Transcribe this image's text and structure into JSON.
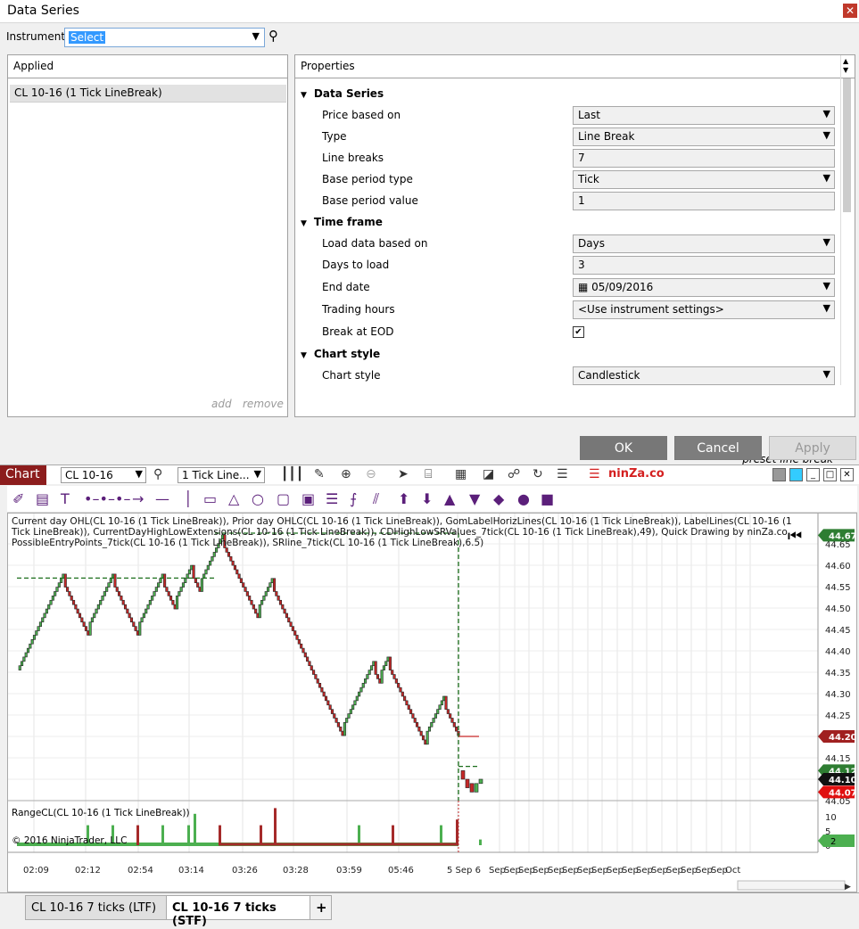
{
  "dialog": {
    "title": "Data Series",
    "close": "✕"
  },
  "instrument": {
    "label": "Instrument",
    "value": "Select"
  },
  "applied": {
    "header": "Applied",
    "items": [
      "CL 10-16 (1 Tick LineBreak)"
    ],
    "add": "add",
    "remove": "remove"
  },
  "properties": {
    "header": "Properties",
    "sections": [
      {
        "title": "Data Series",
        "rows": [
          {
            "label": "Price based on",
            "value": "Last",
            "kind": "select"
          },
          {
            "label": "Type",
            "value": "Line Break",
            "kind": "select"
          },
          {
            "label": "Line breaks",
            "value": "7",
            "kind": "text"
          },
          {
            "label": "Base period type",
            "value": "Tick",
            "kind": "select"
          },
          {
            "label": "Base period value",
            "value": "1",
            "kind": "text"
          }
        ]
      },
      {
        "title": "Time frame",
        "rows": [
          {
            "label": "Load data based on",
            "value": "Days",
            "kind": "select"
          },
          {
            "label": "Days to load",
            "value": "3",
            "kind": "text"
          },
          {
            "label": "End date",
            "value": "05/09/2016",
            "kind": "date"
          },
          {
            "label": "Trading hours",
            "value": "<Use instrument settings>",
            "kind": "select"
          },
          {
            "label": "Break at EOD",
            "value": "✔",
            "kind": "check"
          }
        ]
      },
      {
        "title": "Chart style",
        "rows": [
          {
            "label": "Chart style",
            "value": "Candlestick",
            "kind": "select"
          }
        ]
      }
    ],
    "preset": "preset line break"
  },
  "buttons": {
    "ok": "OK",
    "cancel": "Cancel",
    "apply": "Apply"
  },
  "chartbar": {
    "tab": "Chart",
    "instrument": "CL 10-16",
    "period": "1 Tick Line...",
    "brand": "ninZa.co"
  },
  "chart": {
    "indicators_text": "Current day OHL(CL 10-16 (1 Tick LineBreak)), Prior day OHLC(CL 10-16 (1 Tick LineBreak)), GomLabelHorizLines(CL 10-16 (1 Tick LineBreak)), LabelLines(CL 10-16 (1 Tick LineBreak)), CurrentDayHighLowExtensions(CL 10-16 (1 Tick LineBreak)), CDHighLowSRValues_7tick(CL 10-16 (1 Tick LineBreak),49), Quick Drawing by ninZa.co, PossibleEntryPoints_7tick(CL 10-16 (1 Tick LineBreak)), SRline_7tick(CL 10-16 (1 Tick LineBreak),6.5)",
    "y_ticks": [
      "44.65",
      "44.60",
      "44.55",
      "44.50",
      "44.45",
      "44.40",
      "44.35",
      "44.30",
      "44.25",
      "44.20",
      "44.15",
      "44.10",
      "44.05"
    ],
    "price_labels": [
      {
        "text": "44.67",
        "color": "#2e7d32",
        "y": 44.67
      },
      {
        "text": "44.20",
        "color": "#a02020",
        "y": 44.2
      },
      {
        "text": "44.12",
        "color": "#2e7d32",
        "y": 44.12
      },
      {
        "text": "44.10",
        "color": "#111111",
        "y": 44.1
      },
      {
        "text": "44.07",
        "color": "#e01010",
        "y": 44.07
      }
    ],
    "subpanel_label": "RangeCL(CL 10-16 (1 Tick LineBreak))",
    "copyright": "© 2016 NinjaTrader, LLC",
    "sub_ticks": [
      "10",
      "5",
      "0"
    ],
    "sub_label": "2",
    "x_labels": [
      "02:09",
      "02:12",
      "02:54",
      "03:14",
      "03:26",
      "03:28",
      "03:59",
      "05:46",
      "5 Sep 6",
      "Sep",
      "Sep",
      "Sep",
      "Sep",
      "Sep",
      "Sep",
      "Sep",
      "Sep",
      "Sep",
      "Sep",
      "Sep",
      "Sep",
      "Sep",
      "Sep",
      "Sep",
      "Sep",
      "Oct"
    ],
    "colors": {
      "up": "#4caf50",
      "down": "#c62828",
      "dash": "#1b6e1b",
      "outline": "#222222"
    }
  },
  "bottom_tabs": [
    "CL 10-16 7 ticks (LTF)",
    "CL 10-16 7 ticks (STF)",
    "+"
  ]
}
